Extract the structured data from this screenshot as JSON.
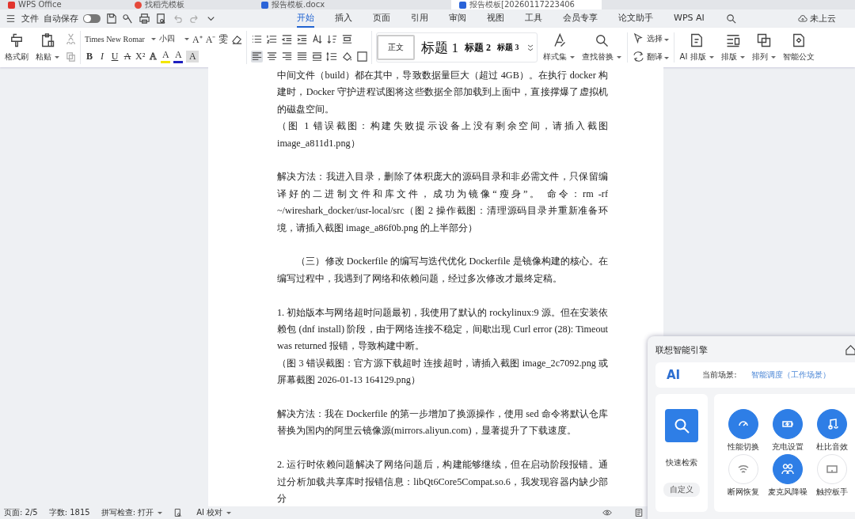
{
  "window_tabs": [
    {
      "label": "WPS Office",
      "kind": "wps",
      "selected": false
    },
    {
      "label": "找稻壳模板",
      "kind": "template",
      "selected": false
    },
    {
      "label": "报告模板.docx",
      "kind": "word",
      "selected": false
    },
    {
      "label": "报告模板[20260117223406",
      "kind": "word",
      "selected": true
    }
  ],
  "menu": {
    "file": "文件",
    "autosave": {
      "label": "自动保存",
      "on": false
    },
    "tabs": [
      {
        "label": "开始",
        "selected": true
      },
      {
        "label": "插入",
        "selected": false
      },
      {
        "label": "页面",
        "selected": false
      },
      {
        "label": "引用",
        "selected": false
      },
      {
        "label": "审阅",
        "selected": false
      },
      {
        "label": "视图",
        "selected": false
      },
      {
        "label": "工具",
        "selected": false
      },
      {
        "label": "会员专享",
        "selected": false
      },
      {
        "label": "论文助手",
        "selected": false
      },
      {
        "label": "WPS AI",
        "selected": false
      }
    ],
    "cloud": "未上云"
  },
  "ribbon": {
    "clipboard": [
      {
        "kind": "brush",
        "label": "格式刷",
        "menu": false
      },
      {
        "kind": "clipboard",
        "label": "粘贴",
        "menu": true
      }
    ],
    "font_family": "Times New Romar",
    "font_size": "小四",
    "font_row1": [
      "A⁺",
      "A⁻",
      "雯"
    ],
    "font_row2": [
      {
        "text": "B",
        "kind": "bold"
      },
      {
        "text": "I",
        "kind": "italic"
      },
      {
        "text": "U",
        "kind": "underline"
      },
      {
        "text": "A",
        "kind": "strike"
      },
      {
        "text": "X²",
        "kind": "plain"
      },
      {
        "text": "A",
        "kind": "outline"
      },
      {
        "text": "A",
        "kind": "highlight"
      },
      {
        "text": "A",
        "kind": "color"
      },
      {
        "text": "A",
        "kind": "shade"
      }
    ],
    "styles": [
      {
        "label": "正文",
        "kind": "body",
        "selected": true
      },
      {
        "label": "标题 1",
        "kind": "h1",
        "selected": false
      },
      {
        "label": "标题 2",
        "kind": "h2",
        "selected": false
      },
      {
        "label": "标题 3",
        "kind": "h3",
        "selected": false
      }
    ],
    "style_set": {
      "kind": "style",
      "label": "样式集",
      "menu": true
    },
    "find": {
      "kind": "search",
      "label": "查找替换",
      "menu": true
    },
    "small_tools": [
      {
        "kind": "cursor",
        "label": "选择",
        "menu": true
      },
      {
        "kind": "translate",
        "label": "翻译",
        "menu": true
      }
    ],
    "layout_tools": [
      {
        "kind": "docai",
        "label": "AI 排版",
        "menu": true
      },
      {
        "kind": "layout",
        "label": "排版",
        "menu": true
      },
      {
        "kind": "arrange",
        "label": "排列",
        "menu": true
      },
      {
        "kind": "doc",
        "label": "智能公文",
        "menu": false
      }
    ]
  },
  "document": {
    "paragraphs": [
      {
        "kind": "cont",
        "text": "中间文件（build）都在其中，导致数据量巨大（超过 4GB）。在执行 docker 构建时，Docker 守护进程试图将这些数据全部加载到上面中，直接撑爆了虚拟机的磁盘空间。"
      },
      {
        "kind": "cont",
        "text": "（图 1 错误截图：构建失败提示设备上没有剩余空间，请插入截图 image_a811d1.png）"
      },
      {
        "kind": "block",
        "text": "解决方法：我进入目录，删除了体积庞大的源码目录和非必需文件，只保留编译好的二进制文件和库文件，成功为镜像“瘦身”。 命令：rm -rf ~/wireshark_docker/usr-local/src（图 2 操作截图：清理源码目录并重新准备环境，请插入截图 image_a86f0b.png 的上半部分）"
      },
      {
        "kind": "indent",
        "text": "（三）修改 Dockerfile 的编写与迭代优化 Dockerfile 是镜像构建的核心。在编写过程中，我遇到了网络和依赖问题，经过多次修改才最终定稿。"
      },
      {
        "kind": "block",
        "text": "1. 初始版本与网络超时问题最初，我使用了默认的 rockylinux:9 源。但在安装依赖包 (dnf install) 阶段，由于网络连接不稳定，间歇出现 Curl error (28): Timeout was returned 报错，导致构建中断。"
      },
      {
        "kind": "cont",
        "text": "（图 3 错误截图：官方源下载超时 连接超时，请插入截图 image_2c7092.png 或屏幕截图 2026-01-13 164129.png）"
      },
      {
        "kind": "block",
        "text": "解决方法：我在 Dockerfile 的第一步增加了换源操作，使用 sed 命令将默认仓库替换为国内的阿里云镜像源(mirrors.aliyun.com)，显著提升了下载速度。"
      },
      {
        "kind": "block",
        "text": "2. 运行时依赖问题解决了网络问题后，构建能够继续，但在启动阶段报错。通过分析加载共享库时报错信息：libQt6Core5Compat.so.6，我发现容器内缺少部分"
      }
    ]
  },
  "status_bar": {
    "page": "页面: 2/5",
    "words": "字数: 1815",
    "spell": "拼写检查: 打开",
    "proof": "AI 校对"
  },
  "assistant_panel": {
    "title": "联想智能引擎",
    "ai": "AI",
    "scene_label": "当前场景:",
    "scene": "智能调度（工作场景）",
    "quick_search": "快速检索",
    "customize": "自定义",
    "tiles": [
      {
        "kind": "gauge",
        "label": "性能切换",
        "on": true
      },
      {
        "kind": "battery",
        "label": "充电设置",
        "on": true
      },
      {
        "kind": "music",
        "label": "杜比音效",
        "on": true
      },
      {
        "kind": "wifi",
        "label": "断网恢复",
        "on": false
      },
      {
        "kind": "people",
        "label": "麦克风降噪",
        "on": true
      },
      {
        "kind": "touchpad",
        "label": "触控板手",
        "on": false
      }
    ]
  }
}
